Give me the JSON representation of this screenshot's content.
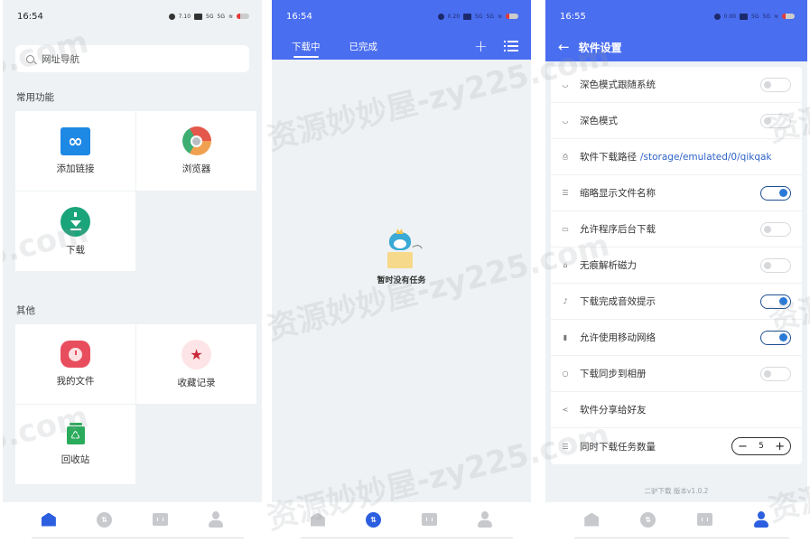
{
  "screens": {
    "home": {
      "status": {
        "time": "16:54",
        "speed": "7.10"
      },
      "search_placeholder": "网址导航",
      "sections": [
        {
          "title": "常用功能",
          "items": [
            {
              "label": "添加链接",
              "icon": "link-icon"
            },
            {
              "label": "浏览器",
              "icon": "browser-icon"
            },
            {
              "label": "下载",
              "icon": "download-icon"
            }
          ]
        },
        {
          "title": "其他",
          "items": [
            {
              "label": "我的文件",
              "icon": "clock-file-icon"
            },
            {
              "label": "收藏记录",
              "icon": "star-icon"
            },
            {
              "label": "回收站",
              "icon": "recycle-bin-icon"
            }
          ]
        }
      ]
    },
    "downloads": {
      "status": {
        "time": "16:54",
        "speed": "0.20"
      },
      "tabs": [
        {
          "label": "下载中",
          "active": true
        },
        {
          "label": "已完成",
          "active": false
        }
      ],
      "add_label": "+",
      "empty_text": "暂时没有任务"
    },
    "settings": {
      "status": {
        "time": "16:55",
        "speed": "0.00"
      },
      "title": "软件设置",
      "back_label": "←",
      "rows": [
        {
          "icon": "moon-icon",
          "glyph": "◡",
          "label": "深色模式跟随系统",
          "control": "toggle",
          "on": false
        },
        {
          "icon": "moon-icon",
          "glyph": "◡",
          "label": "深色模式",
          "control": "toggle",
          "on": false
        },
        {
          "icon": "download-folder-icon",
          "glyph": "⎙",
          "label": "软件下载路径",
          "value": "/storage/emulated/0/qikqak",
          "control": "text"
        },
        {
          "icon": "list-icon",
          "glyph": "☰",
          "label": "缩略显示文件名称",
          "control": "toggle",
          "on": true
        },
        {
          "icon": "message-icon",
          "glyph": "▭",
          "label": "允许程序后台下载",
          "control": "toggle",
          "on": false
        },
        {
          "icon": "magnet-icon",
          "glyph": "⌂",
          "label": "无痕解析磁力",
          "control": "toggle",
          "on": false
        },
        {
          "icon": "sound-icon",
          "glyph": "♪",
          "label": "下载完成音效提示",
          "control": "toggle",
          "on": true
        },
        {
          "icon": "signal-icon",
          "glyph": "▮",
          "label": "允许使用移动网络",
          "control": "toggle",
          "on": true
        },
        {
          "icon": "sync-icon",
          "glyph": "○",
          "label": "下载同步到相册",
          "control": "toggle",
          "on": false
        },
        {
          "icon": "share-icon",
          "glyph": "<",
          "label": "软件分享给好友",
          "control": "none"
        },
        {
          "icon": "list-icon",
          "glyph": "☰",
          "label": "同时下载任务数量",
          "control": "stepper",
          "value": "5",
          "minus": "−",
          "plus": "+"
        }
      ],
      "version": "二驴下载 版本v1.0.2"
    }
  },
  "bottom_nav": [
    {
      "name": "home",
      "icon": "home-icon"
    },
    {
      "name": "downloads",
      "icon": "download-circle-icon"
    },
    {
      "name": "toolbox",
      "icon": "toolbox-icon"
    },
    {
      "name": "profile",
      "icon": "user-icon"
    }
  ],
  "active_nav": [
    "home",
    "downloads",
    "profile"
  ],
  "watermarks": [
    "资源妙妙屋-zy225.com",
    "5.com",
    "资源"
  ],
  "colors": {
    "primary": "#4a6ef0",
    "accent": "#2b79d6",
    "background": "#eef2f4"
  }
}
